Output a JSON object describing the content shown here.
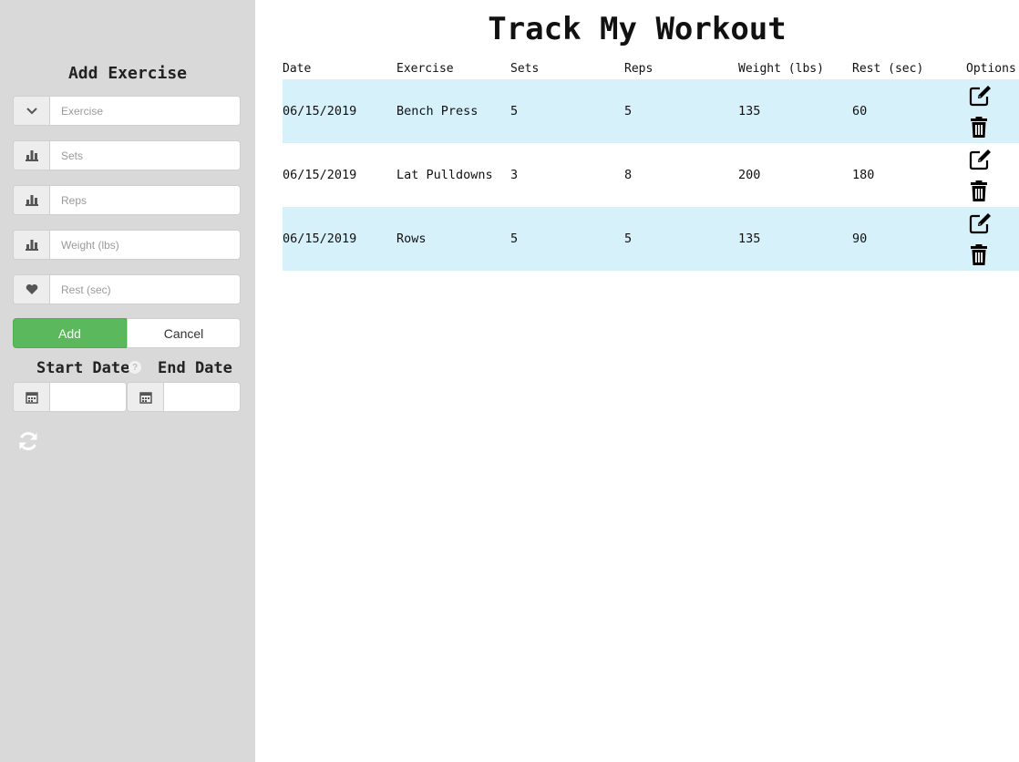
{
  "sidebar": {
    "title": "Add Exercise",
    "fields": [
      {
        "icon": "chevron-down-icon",
        "placeholder": "Exercise",
        "value": ""
      },
      {
        "icon": "bar-chart-icon",
        "placeholder": "Sets",
        "value": ""
      },
      {
        "icon": "bar-chart-icon",
        "placeholder": "Reps",
        "value": ""
      },
      {
        "icon": "bar-chart-icon",
        "placeholder": "Weight (lbs)",
        "value": ""
      },
      {
        "icon": "heart-icon",
        "placeholder": "Rest (sec)",
        "value": ""
      }
    ],
    "add_label": "Add",
    "cancel_label": "Cancel",
    "start_date_label": "Start Date",
    "help_glyph": "?",
    "end_date_label": "End Date",
    "start_date_value": "",
    "end_date_value": "",
    "refresh_icon": "refresh-icon"
  },
  "main": {
    "title": "Track My Workout",
    "columns": [
      "Date",
      "Exercise",
      "Sets",
      "Reps",
      "Weight (lbs)",
      "Rest (sec)",
      "Options"
    ],
    "rows": [
      {
        "date": "06/15/2019",
        "exercise": "Bench Press",
        "sets": "5",
        "reps": "5",
        "weight": "135",
        "rest": "60"
      },
      {
        "date": "06/15/2019",
        "exercise": "Lat Pulldowns",
        "sets": "3",
        "reps": "8",
        "weight": "200",
        "rest": "180"
      },
      {
        "date": "06/15/2019",
        "exercise": "Rows",
        "sets": "5",
        "reps": "5",
        "weight": "135",
        "rest": "90"
      }
    ],
    "row_icons": [
      "edit-icon",
      "trash-icon"
    ]
  },
  "colors": {
    "sidebar_bg": "#d9d9d9",
    "add_button": "#5cb85c",
    "row_highlight": "#d7f1fb"
  }
}
